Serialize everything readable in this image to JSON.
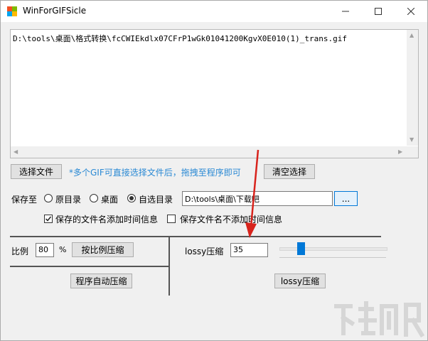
{
  "window": {
    "title": "WinForGIFSicle"
  },
  "file_list": {
    "items": [
      "D:\\tools\\桌面\\格式转换\\fcCWIEkdlx07CFrP1wGk01041200KgvX0E010(1)_trans.gif"
    ]
  },
  "actions": {
    "select_file_label": "选择文件",
    "hint": "*多个GIF可直接选择文件后，拖拽至程序即可",
    "clear_label": "清空选择"
  },
  "save_to": {
    "label": "保存至",
    "options": [
      "原目录",
      "桌面",
      "自选目录"
    ],
    "selected": "自选目录",
    "path_value": "D:\\tools\\桌面\\下载吧",
    "browse_label": "...",
    "add_time_label": "保存的文件名添加时间信息",
    "add_time_checked": true,
    "no_time_label": "保存文件名不添加时间信息",
    "no_time_checked": false
  },
  "ratio": {
    "label": "比例",
    "value": "80",
    "unit": "%",
    "button": "按比例压缩",
    "auto_button": "程序自动压缩"
  },
  "lossy": {
    "label": "lossy压缩",
    "value": "35",
    "slider_fraction": 0.18,
    "button": "lossy压缩"
  },
  "colors": {
    "hint": "#2a89d4",
    "accent": "#0078d7",
    "annotation_arrow": "#d8231c"
  },
  "icons": [
    "app-icon",
    "minimize-icon",
    "maximize-icon",
    "close-icon",
    "checkmark-icon",
    "red-arrow-annotation"
  ]
}
